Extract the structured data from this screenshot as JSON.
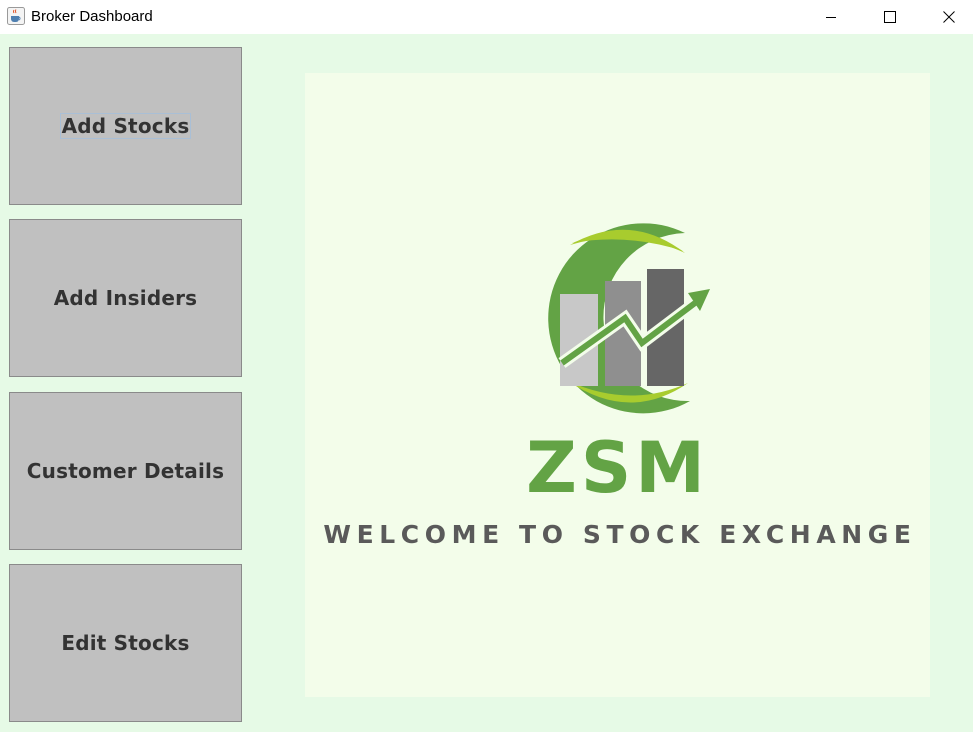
{
  "window": {
    "title": "Broker Dashboard",
    "app_icon": "java-coffee-cup-icon",
    "controls": [
      "minimize-icon",
      "maximize-icon",
      "close-icon"
    ]
  },
  "sidebar": {
    "buttons": [
      {
        "label": "Add Stocks",
        "focused": true
      },
      {
        "label": "Add Insiders"
      },
      {
        "label": "Customer Details"
      },
      {
        "label": "Edit Stocks"
      }
    ]
  },
  "main": {
    "logo": {
      "brand": "ZSM",
      "tagline": "WELCOME TO STOCK EXCHANGE",
      "icon": "rising-bar-chart-arrow-icon"
    }
  },
  "colors": {
    "background": "#e6fae6",
    "panel": "#f3fdea",
    "button": "#c0c0c0",
    "button_text": "#333333",
    "brand_green": "#63a345",
    "lime_green": "#a8cc2e",
    "tagline_gray": "#5a5a5a"
  }
}
